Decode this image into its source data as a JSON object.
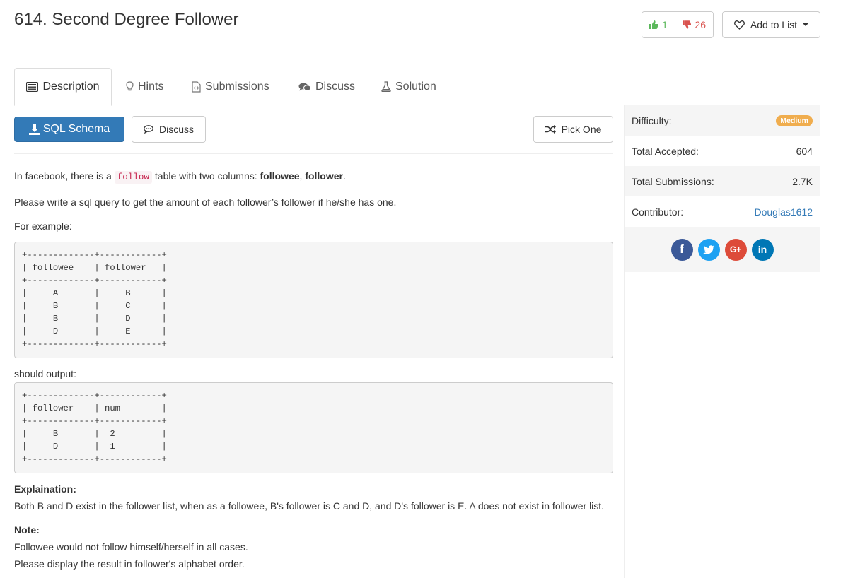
{
  "problem": {
    "title": "614. Second Degree Follower",
    "likes": "1",
    "dislikes": "26",
    "add_to_list": "Add to List"
  },
  "tabs": [
    {
      "label": "Description",
      "icon": "description-icon",
      "active": true
    },
    {
      "label": "Hints",
      "icon": "lightbulb-icon"
    },
    {
      "label": "Submissions",
      "icon": "code-file-icon"
    },
    {
      "label": "Discuss",
      "icon": "comments-icon"
    },
    {
      "label": "Solution",
      "icon": "flask-icon"
    }
  ],
  "toolbar": {
    "sql_schema": "SQL Schema",
    "discuss": "Discuss",
    "pick_one": "Pick One"
  },
  "content": {
    "p1_prefix": "In facebook, there is a ",
    "p1_code": "follow",
    "p1_mid": " table with two columns: ",
    "p1_b1": "followee",
    "p1_sep": ", ",
    "p1_b2": "follower",
    "p1_end": ".",
    "p2": "Please write a sql query to get the amount of each follower’s follower if he/she has one.",
    "p3": "For example:",
    "example_table": "+-------------+------------+\n| followee    | follower   |\n+-------------+------------+\n|     A       |     B      |\n|     B       |     C      |\n|     B       |     D      |\n|     D       |     E      |\n+-------------+------------+",
    "should_output": "should output:",
    "output_table": "+-------------+------------+\n| follower    | num        |\n+-------------+------------+\n|     B       |  2         |\n|     D       |  1         |\n+-------------+------------+",
    "explanation_heading": "Explaination:",
    "explanation": "Both B and D exist in the follower list, when as a followee, B's follower is C and D, and D's follower is E. A does not exist in follower list.",
    "note_heading": "Note:",
    "note1": "Followee would not follow himself/herself in all cases.",
    "note2": "Please display the result in follower's alphabet order."
  },
  "sidebar": {
    "difficulty_label": "Difficulty:",
    "difficulty_value": "Medium",
    "accepted_label": "Total Accepted:",
    "accepted_value": "604",
    "submissions_label": "Total Submissions:",
    "submissions_value": "2.7K",
    "contributor_label": "Contributor:",
    "contributor_value": "Douglas1612",
    "share": [
      {
        "name": "facebook",
        "glyph": "f",
        "color": "#3b5998"
      },
      {
        "name": "twitter",
        "glyph": "",
        "color": "#1da1f2"
      },
      {
        "name": "google-plus",
        "glyph": "G+",
        "color": "#dd4b39"
      },
      {
        "name": "linkedin",
        "glyph": "in",
        "color": "#0077b5"
      }
    ]
  },
  "colors": {
    "primary": "#337ab7",
    "like": "#5cb85c",
    "dislike": "#d9534f",
    "medium": "#f0ad4e"
  }
}
